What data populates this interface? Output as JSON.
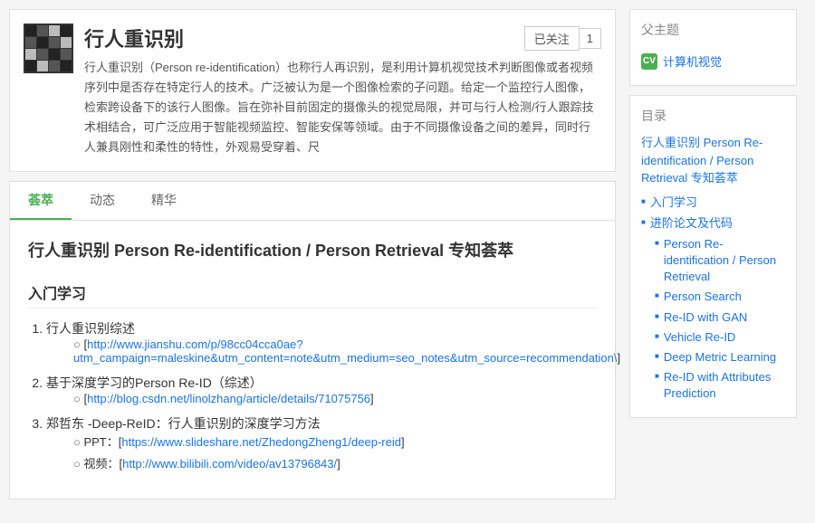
{
  "header": {
    "title": "行人重识别",
    "follow_label": "已关注",
    "follow_count": "1",
    "description": "行人重识别（Person re-identification）也称行人再识别，是利用计算机视觉技术判断图像或者视频序列中是否存在特定行人的技术。广泛被认为是一个图像检索的子问题。给定一个监控行人图像，检索跨设备下的该行人图像。旨在弥补目前固定的摄像头的视觉局限，并可与行人检测/行人跟踪技术相结合，可广泛应用于智能视频监控、智能安保等领域。由于不同摄像设备之间的差异，同时行人兼具刚性和柔性的特性，外观易受穿着、尺"
  },
  "tabs": {
    "items": [
      "荟萃",
      "动态",
      "精华"
    ],
    "active": 0
  },
  "article": {
    "title": "行人重识别 Person Re-identification / Person Retrieval 专知荟萃",
    "section1": "入门学习",
    "list_items": [
      {
        "text": "行人重识别综述",
        "links": [
          {
            "url": "http://www.jianshu.com/p/98cc04cca0ae?utm_campaign=maleskine&utm_content=note&utm_medium=seo_notes&utm_source=recommendation\\",
            "label": "http://www.jianshu.com/p/98cc04cca0ae?utm_campaign=maleskine&utm_content=note&utm_medium=seo_notes&utm_source=recommendation\\"
          }
        ]
      },
      {
        "text": "基于深度学习的Person Re-ID（综述）",
        "links": [
          {
            "url": "http://blog.csdn.net/linolzhang/article/details/71075756",
            "label": "http://blog.csdn.net/linolzhang/article/details/71075756"
          }
        ]
      },
      {
        "text": "郑哲东 -Deep-ReID：行人重识别的深度学习方法",
        "links": [
          {
            "type": "ppt",
            "prefix": "PPT：[",
            "url": "https://www.slideshare.net/ZhedongZheng1/deep-reid",
            "label": "https://www.slideshare.net/ZhedongZheng1/deep-reid",
            "suffix": "]"
          },
          {
            "type": "video",
            "prefix": "视频：[",
            "url": "http://www.bilibili.com/video/av13796843/",
            "label": "http://www.bilibili.com/video/av13796843/",
            "suffix": "]"
          }
        ]
      }
    ]
  },
  "sidebar": {
    "parent_topic_title": "父主题",
    "parent_topic_label": "计算机视觉",
    "toc_title": "目录",
    "toc_main_link": "行人重识别 Person Re-identification / Person Retrieval 专知荟萃",
    "toc_items": [
      {
        "label": "入门学习"
      },
      {
        "label": "进阶论文及代码"
      }
    ],
    "toc_sub_items": [
      {
        "label": "Person Re-identification / Person Retrieval"
      },
      {
        "label": "Person Search"
      },
      {
        "label": "Re-ID with GAN"
      },
      {
        "label": "Vehicle Re-ID"
      },
      {
        "label": "Deep Metric Learning"
      },
      {
        "label": "Re-ID with Attributes Prediction"
      }
    ]
  }
}
